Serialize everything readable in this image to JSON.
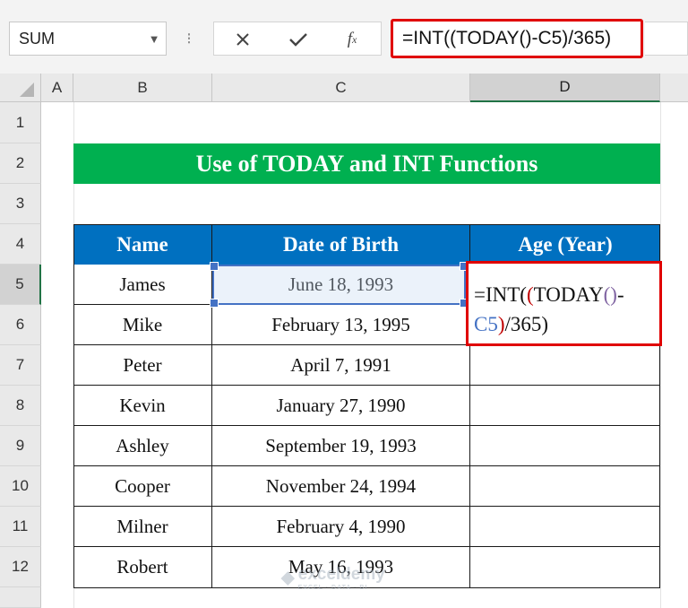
{
  "formula_bar": {
    "name_box": "SUM",
    "formula": "=INT((TODAY()-C5)/365)",
    "cancel_icon": "close-icon",
    "enter_icon": "check-icon",
    "function_icon": "fx-icon"
  },
  "columns": [
    "A",
    "B",
    "C",
    "D"
  ],
  "active_column": "D",
  "rows": [
    "1",
    "2",
    "3",
    "4",
    "5",
    "6",
    "7",
    "8",
    "9",
    "10",
    "11",
    "12"
  ],
  "active_row": "5",
  "title": "Use of TODAY and INT Functions",
  "table": {
    "headers": [
      "Name",
      "Date of Birth",
      "Age (Year)"
    ],
    "rows": [
      {
        "name": "James",
        "dob": "June 18, 1993"
      },
      {
        "name": "Mike",
        "dob": "February 13, 1995"
      },
      {
        "name": "Peter",
        "dob": "April 7, 1991"
      },
      {
        "name": "Kevin",
        "dob": "January 27, 1990"
      },
      {
        "name": "Ashley",
        "dob": "September 19, 1993"
      },
      {
        "name": "Cooper",
        "dob": "November 24, 1994"
      },
      {
        "name": "Milner",
        "dob": "February 4, 1990"
      },
      {
        "name": "Robert",
        "dob": "May 16, 1993"
      }
    ]
  },
  "editing_cell": {
    "part1": "=INT(",
    "paren_open_1": "(",
    "func": "TODAY",
    "paren_open_2": "(",
    "paren_close_2": ")",
    "dash": "-",
    "ref": "C5",
    "paren_close_1": ")",
    "tail": "/365)"
  },
  "watermark": {
    "name": "exceldemy",
    "tagline": "EXCEL · DATA · BI"
  },
  "colors": {
    "title_bg": "#00b050",
    "header_bg": "#0070c0",
    "highlight": "#e00000",
    "selection": "#4472c4"
  }
}
